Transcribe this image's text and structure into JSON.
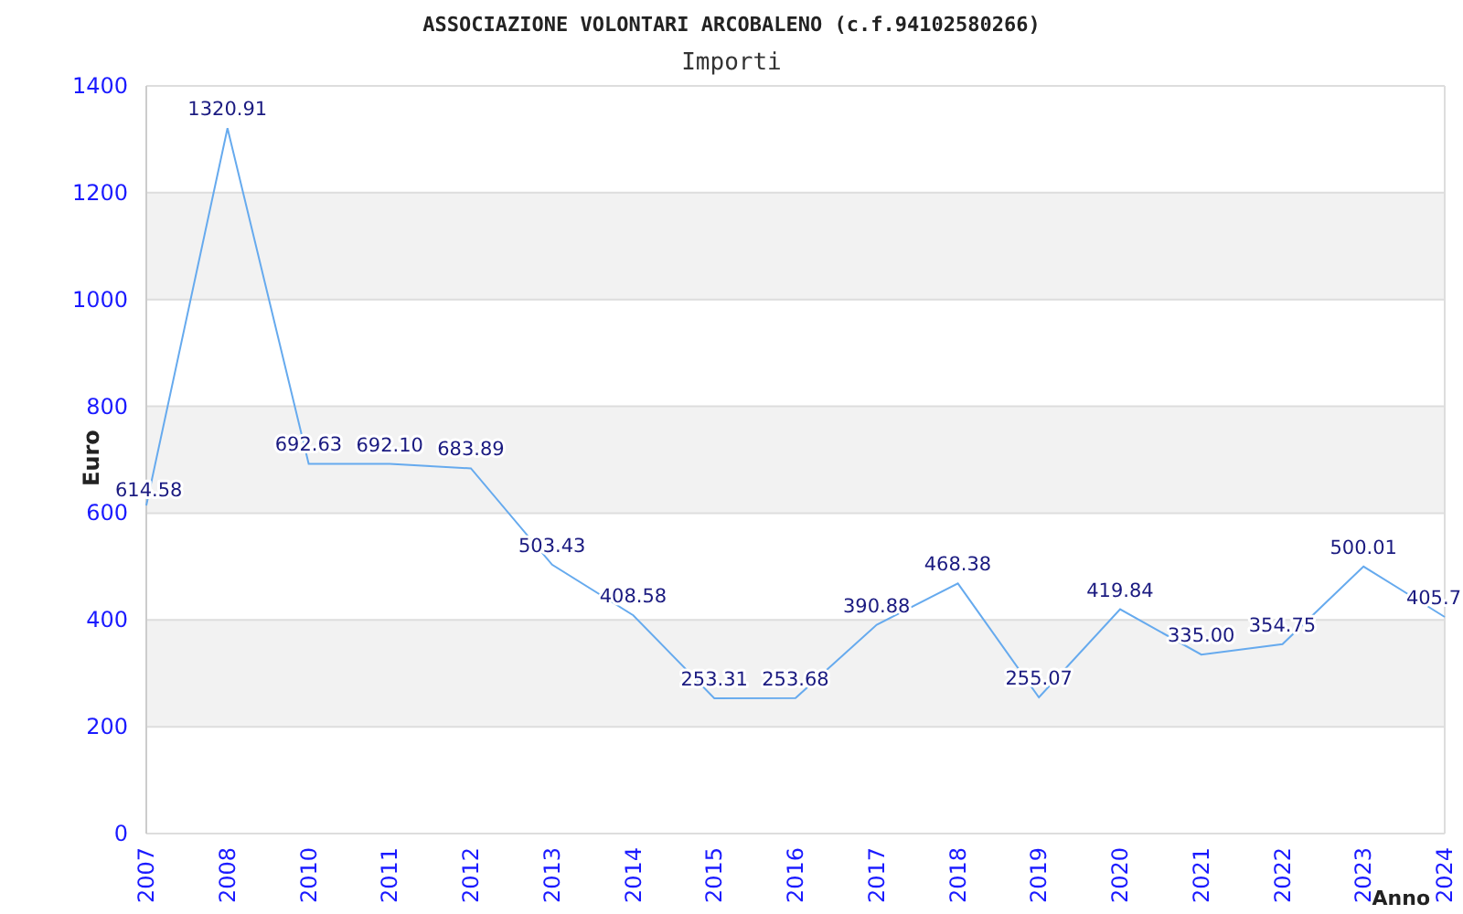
{
  "chart_data": {
    "type": "line",
    "title": "ASSOCIAZIONE VOLONTARI ARCOBALENO (c.f.94102580266)",
    "subtitle": "Importi",
    "xlabel": "Anno",
    "ylabel": "Euro",
    "categories": [
      "2007",
      "2008",
      "2010",
      "2011",
      "2012",
      "2013",
      "2014",
      "2015",
      "2016",
      "2017",
      "2018",
      "2019",
      "2020",
      "2021",
      "2022",
      "2023",
      "2024"
    ],
    "series": [
      {
        "color": "#66aaee",
        "values": [
          614.58,
          1320.91,
          692.63,
          692.1,
          683.89,
          503.43,
          408.58,
          253.31,
          253.68,
          390.88,
          468.38,
          255.07,
          419.84,
          335.0,
          354.75,
          500.01,
          405.7
        ],
        "value_labels": [
          "614.58",
          "1320.91",
          "692.63",
          "692.10",
          "683.89",
          "503.43",
          "408.58",
          "253.31",
          "253.68",
          "390.88",
          "468.38",
          "255.07",
          "419.84",
          "335.00",
          "354.75",
          "500.01",
          "405.7"
        ]
      }
    ],
    "ylim": [
      0,
      1400
    ],
    "yticks": [
      0,
      200,
      400,
      600,
      800,
      1000,
      1200,
      1400
    ],
    "data_labels": true,
    "grid": true
  }
}
